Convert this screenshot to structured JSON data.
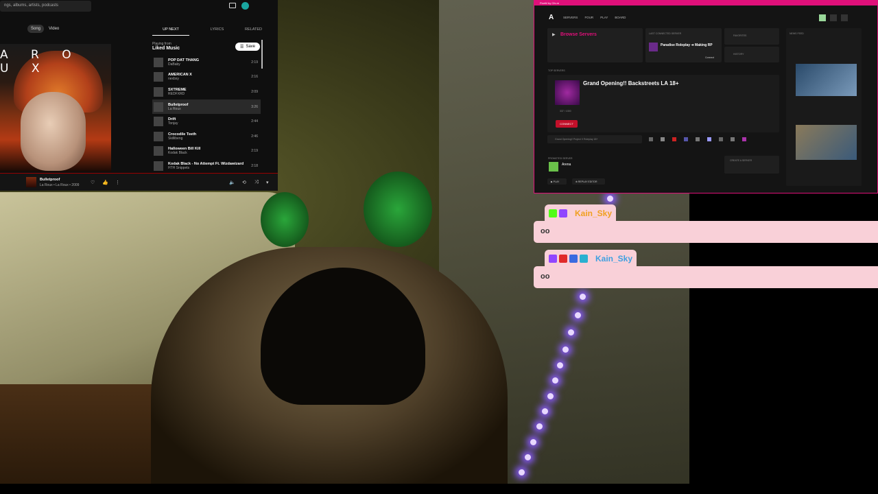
{
  "ytm": {
    "search_placeholder": "ngs, albums, artists, podcasts",
    "toggle": [
      "Song",
      "Video"
    ],
    "art_text": "A  R O U X",
    "tabs": [
      "UP NEXT",
      "LYRICS",
      "RELATED"
    ],
    "playing_from_label": "Playing from",
    "playlist": "Liked Music",
    "save_label": "Save",
    "queue": [
      {
        "title": "POP DAT THANG",
        "artist": "DaBaby",
        "duration": "2:19"
      },
      {
        "title": "AMERICAN X",
        "artist": "nexbxy",
        "duration": "2:16"
      },
      {
        "title": "SXTREME",
        "artist": "REDFXRD",
        "duration": "2:09"
      },
      {
        "title": "Bulletproof",
        "artist": "La Roux",
        "duration": "3:26",
        "now": true
      },
      {
        "title": "Drift",
        "artist": "Tonjay",
        "duration": "2:44"
      },
      {
        "title": "Crocodile Teeth",
        "artist": "Skillibeng",
        "duration": "2:46"
      },
      {
        "title": "Halloween Bill Kill",
        "artist": "Kodak Black",
        "duration": "2:19"
      },
      {
        "title": "Kodak Black - No Attempt Ft. Wizdawizard",
        "artist": "HTH Snippets",
        "duration": "2:18"
      }
    ],
    "player": {
      "title": "Bulletproof",
      "subtitle": "La Roux • La Roux • 2009"
    }
  },
  "fivem": {
    "titlebar": "FiveM by Cfx.re",
    "logo": "A",
    "nav": [
      "SERVERS",
      "FOUR",
      "PLAY",
      "BOARD"
    ],
    "browse": "Browse Servers",
    "last_connected_label": "LAST CONNECTED SERVER",
    "last_server": "Paradise Roleplay ➜ Making RP",
    "last_connect": "Connect",
    "favorites": "FAVORITES",
    "history": "HISTORY",
    "news_label": "NEWS FEED",
    "top_servers_label": "TOP SERVERS",
    "featured_title": "Grand Opening!! Backstreets LA 18+",
    "connect": "CONNECT",
    "players": "337 / 1000",
    "search_value": "Grand Opening!! Project X Roleplay 18+",
    "platform_label": "PROMOTED SERVER",
    "promo_name": "Arena",
    "create_server": "CREATE A SERVER",
    "play_btn": "▶ PLAY",
    "replay_btn": "⊕ REPLAY EDITOR"
  },
  "chat": [
    {
      "user": "Kain_Sky",
      "message": "oo",
      "name_color": "#f0a020"
    },
    {
      "user": "Kain_Sky",
      "message": "oo",
      "name_color": "#3fa0e0"
    }
  ],
  "colors": {
    "fivem_accent": "#e0107a",
    "chat_bg": "#f9d0d8",
    "yt_bg": "#0f0f0f"
  }
}
